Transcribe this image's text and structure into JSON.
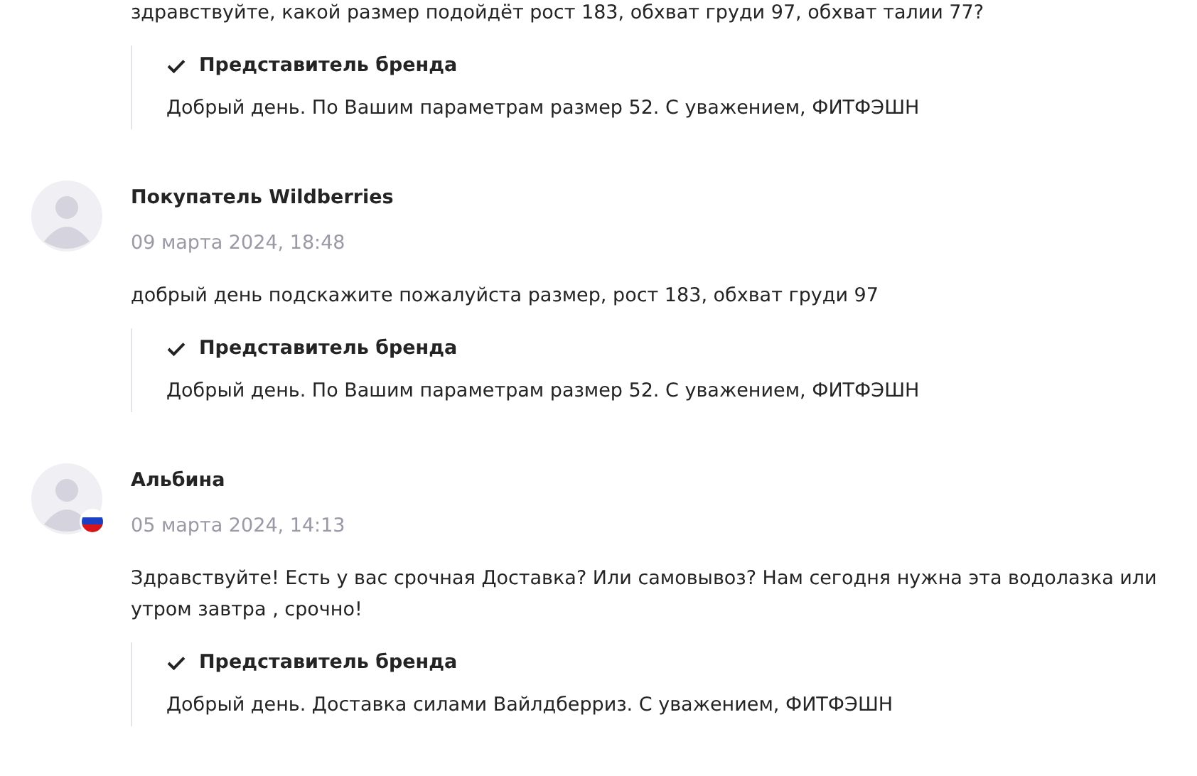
{
  "questions": [
    {
      "text": "здравствуйте, какой размер подойдёт рост 183, обхват груди 97, обхват талии 77?",
      "answer": {
        "verified": true,
        "author": "Представитель бренда",
        "text": "Добрый день. По Вашим параметрам размер 52. С уважением, ФИТФЭШН"
      }
    },
    {
      "author": "Покупатель Wildberries",
      "flag": false,
      "date": "09 марта 2024, 18:48",
      "text": "добрый день подскажите пожалуйста размер, рост 183, обхват груди 97",
      "answer": {
        "verified": true,
        "author": "Представитель бренда",
        "text": "Добрый день. По Вашим параметрам размер 52. С уважением, ФИТФЭШН"
      }
    },
    {
      "author": "Альбина",
      "flag": true,
      "date": "05 марта 2024, 14:13",
      "text": "Здравствуйте! Есть у вас срочная Доставка? Или самовывоз? Нам сегодня нужна эта водолазка или утром завтра , срочно!",
      "answer": {
        "verified": true,
        "author": "Представитель бренда",
        "text": "Добрый день. Доставка силами Вайлдберриз. С уважением, ФИТФЭШН"
      }
    }
  ]
}
